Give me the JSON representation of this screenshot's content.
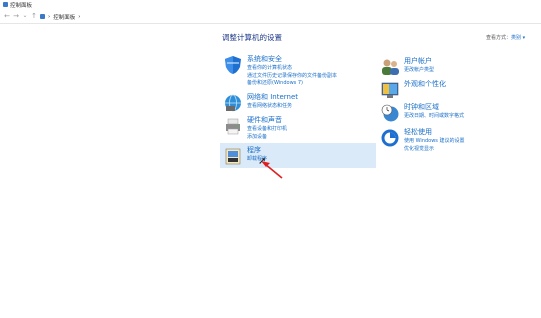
{
  "window": {
    "title": "控制面板"
  },
  "nav": {
    "back": "←",
    "forward": "→",
    "recent": "⌄",
    "up": "↑",
    "path": "控制面板",
    "sep": "›"
  },
  "page": {
    "heading": "调整计算机的设置",
    "view_label": "查看方式：",
    "view_value": "类别 ▾"
  },
  "left": [
    {
      "title": "系统和安全",
      "links": [
        "查看你的计算机状态",
        "通过文件历史记录保存你的文件备份副本",
        "备份和还原(Windows 7)"
      ]
    },
    {
      "title": "网络和 Internet",
      "links": [
        "查看网络状态和任务"
      ]
    },
    {
      "title": "硬件和声音",
      "links": [
        "查看设备和打印机",
        "添加设备"
      ]
    },
    {
      "title": "程序",
      "links": [
        "卸载程序"
      ]
    }
  ],
  "right": [
    {
      "title": "用户帐户",
      "links": [
        "更改帐户类型"
      ]
    },
    {
      "title": "外观和个性化",
      "links": []
    },
    {
      "title": "时钟和区域",
      "links": [
        "更改日期、时间或数字格式"
      ]
    },
    {
      "title": "轻松使用",
      "links": [
        "使用 Windows 建议的设置",
        "优化视觉显示"
      ]
    }
  ],
  "colors": {
    "link": "#1a6fc8",
    "heading": "#1e3a8a",
    "highlight": "#dbeaf8",
    "arrow": "#e02020"
  },
  "icons": [
    "shield-icon",
    "network-globe-icon",
    "printer-icon",
    "programs-box-icon",
    "users-icon",
    "appearance-icon",
    "clock-globe-icon",
    "ease-of-access-icon"
  ]
}
